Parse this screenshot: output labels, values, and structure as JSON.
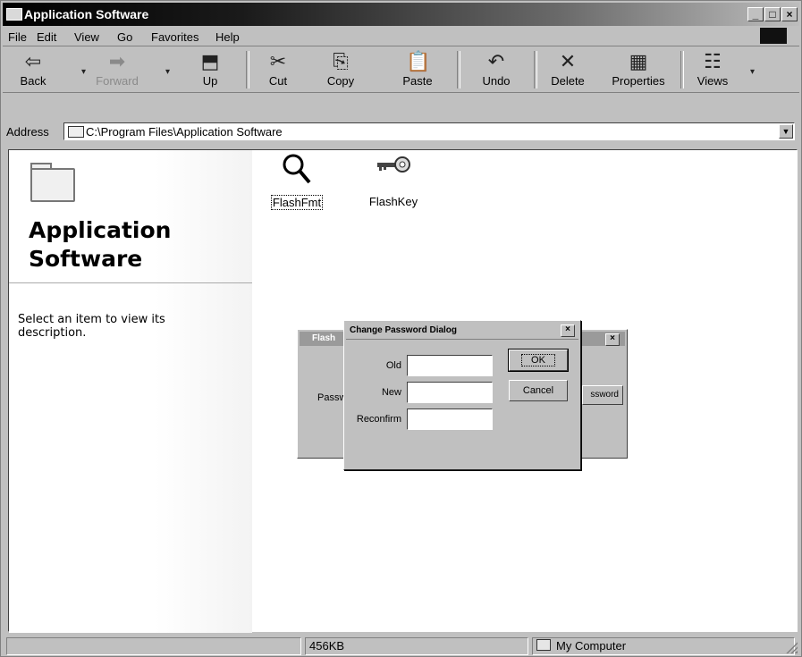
{
  "window": {
    "title": "Application Software"
  },
  "menu": [
    "File",
    "Edit",
    "View",
    "Go",
    "Favorites",
    "Help"
  ],
  "toolbar": {
    "back": "Back",
    "forward": "Forward",
    "up": "Up",
    "cut": "Cut",
    "copy": "Copy",
    "paste": "Paste",
    "undo": "Undo",
    "delete": "Delete",
    "properties": "Properties",
    "views": "Views"
  },
  "address": {
    "label": "Address",
    "value": "C:\\Program Files\\Application Software"
  },
  "left_panel": {
    "title_line1": "Application",
    "title_line2": "Software",
    "description": "Select an item to view its description."
  },
  "files": [
    {
      "name": "FlashFmt",
      "icon": "magnifier-icon",
      "selected": true
    },
    {
      "name": "FlashKey",
      "icon": "key-icon",
      "selected": false
    }
  ],
  "background_dialog": {
    "title": "Flash",
    "label": "Passw",
    "button": "ssword"
  },
  "dialog": {
    "title": "Change Password Dialog",
    "fields": [
      {
        "label": "Old",
        "value": ""
      },
      {
        "label": "New",
        "value": ""
      },
      {
        "label": "Reconfirm",
        "value": ""
      }
    ],
    "ok": "OK",
    "cancel": "Cancel"
  },
  "status": {
    "size": "456KB",
    "zone": "My Computer"
  }
}
